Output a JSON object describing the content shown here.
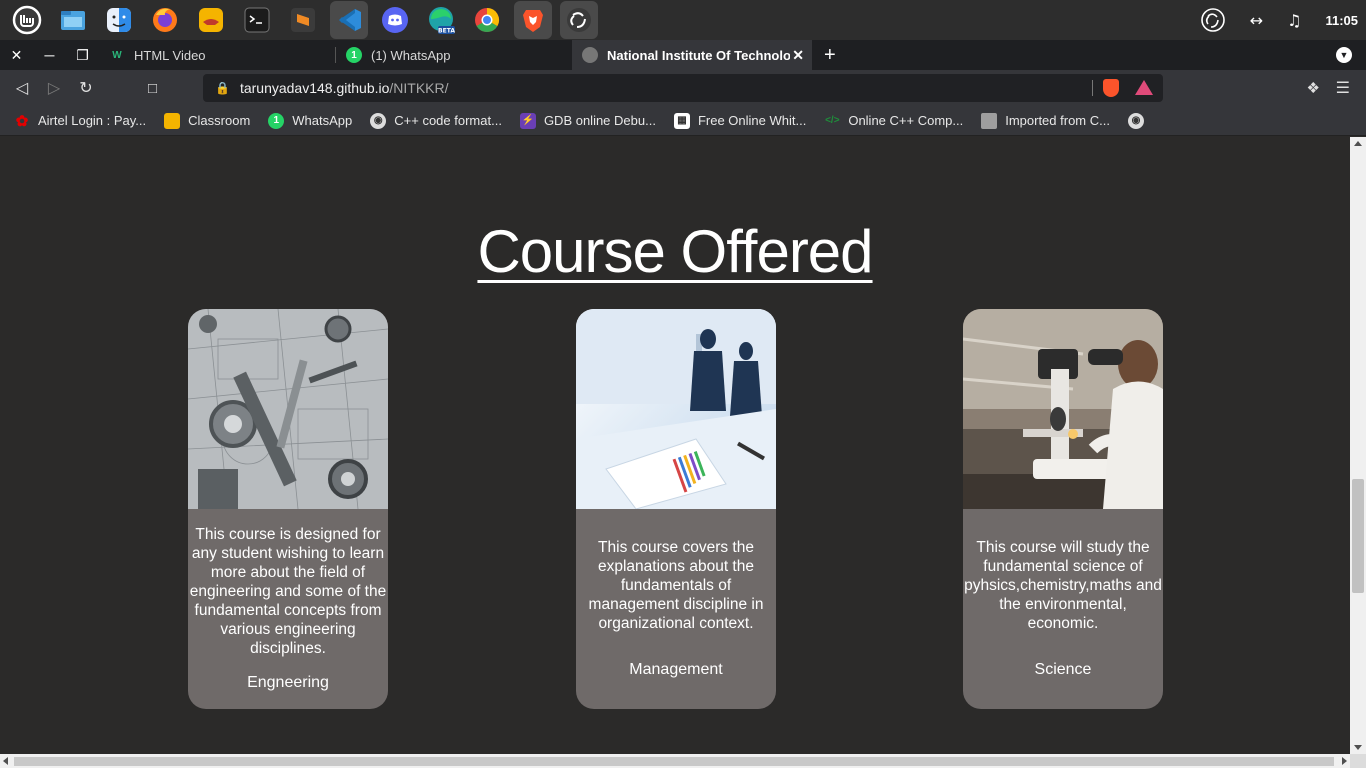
{
  "taskbar": {
    "apps": [
      {
        "name": "mint-menu-icon",
        "glyph": "m",
        "color": "#3a3a3a"
      },
      {
        "name": "files-icon",
        "glyph": "",
        "color": "#4aa3df"
      },
      {
        "name": "finder-icon",
        "glyph": "",
        "color": "#3a8fe8"
      },
      {
        "name": "firefox-icon",
        "glyph": "",
        "color": "#ff7a1a"
      },
      {
        "name": "genie-icon",
        "glyph": "",
        "color": "#f5b400"
      },
      {
        "name": "terminal-icon",
        "glyph": ">_",
        "color": "#1b1b1b"
      },
      {
        "name": "sublime-icon",
        "glyph": "S",
        "color": "#f08a24"
      },
      {
        "name": "vscode-icon",
        "glyph": "",
        "color": "#2d8cdb"
      },
      {
        "name": "discord-icon",
        "glyph": "",
        "color": "#5865f2"
      },
      {
        "name": "edge-beta-icon",
        "glyph": "",
        "color": "#1fa3a8"
      },
      {
        "name": "chrome-icon",
        "glyph": "",
        "color": "#e8453c"
      },
      {
        "name": "brave-icon",
        "glyph": "",
        "color": "#fb542b"
      },
      {
        "name": "obs-icon",
        "glyph": "",
        "color": "#444444"
      }
    ],
    "clock": "11:05"
  },
  "tabs": [
    {
      "title": "HTML Video",
      "favicon_color": "#1e1f22",
      "favicon_text": "W"
    },
    {
      "title": "(1) WhatsApp",
      "favicon_color": "#25d366",
      "favicon_text": "1"
    },
    {
      "title": "National Institute Of Technolo",
      "favicon_color": "#666666",
      "favicon_text": "",
      "active": true
    }
  ],
  "address": {
    "host": "tarunyadav148.github.io",
    "path": "/NITKKR/"
  },
  "bookmarks": [
    {
      "label": "Airtel Login : Pay...",
      "icon_color": "#e40000"
    },
    {
      "label": "Classroom",
      "icon_color": "#f4b400"
    },
    {
      "label": "WhatsApp",
      "icon_color": "#25d366"
    },
    {
      "label": "C++ code format...",
      "icon_color": "#555555"
    },
    {
      "label": "GDB online Debu...",
      "icon_color": "#6a3fb5"
    },
    {
      "label": "Free Online Whit...",
      "icon_color": "#777777"
    },
    {
      "label": "Online C++ Comp...",
      "icon_color": "#1e8f3a"
    },
    {
      "label": "Imported from C...",
      "icon_color": "#9e9e9e"
    },
    {
      "label": "",
      "icon_color": "#555555"
    }
  ],
  "page": {
    "heading": "Course Offered",
    "courses": [
      {
        "name": "Engneering",
        "description": "This course is designed for any student wishing to learn more about the field of engineering and some of the fundamental concepts from various engineering disciplines."
      },
      {
        "name": "Management",
        "description": "This course covers the explanations about the fundamentals of management discipline in organizational context."
      },
      {
        "name": "Science",
        "description": "This course will study the fundamental science of pyhsics,chemistry,maths and the environmental, economic."
      }
    ]
  },
  "colors": {
    "page_bg": "#2b2a29",
    "card_bg": "#6f6a69",
    "tabbar_bg": "#1e1f22",
    "toolbar_bg": "#35363a"
  }
}
